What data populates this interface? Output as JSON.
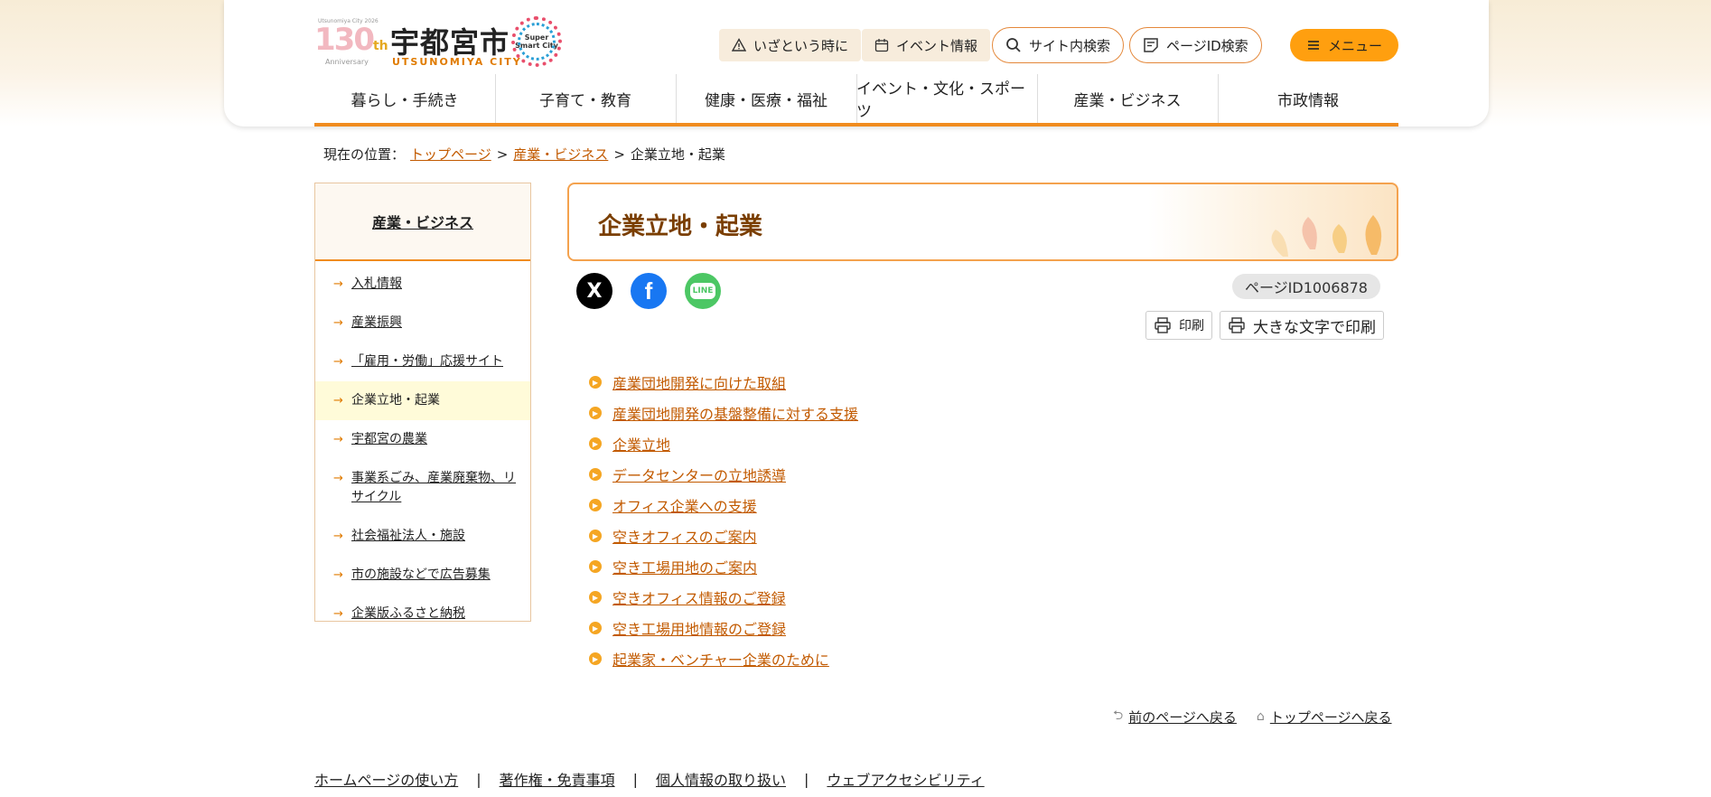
{
  "logo": {
    "anniv_number": "130",
    "anniv_suffix": "th",
    "anniv_top": "Utsunomiya City 2026",
    "anniv_bottom": "Anniversary",
    "city_jp": "宇都宮市",
    "city_en": "UTSUNOMIYA CITY",
    "ssc_text": "Super Smart City"
  },
  "header": {
    "emergency": "いざという時に",
    "events": "イベント情報",
    "site_search": "サイト内検索",
    "pageid_search": "ページID検索",
    "menu": "メニュー"
  },
  "gnav": [
    "暮らし・手続き",
    "子育て・教育",
    "健康・医療・福祉",
    "イベント・文化・スポーツ",
    "産業・ビジネス",
    "市政情報"
  ],
  "breadcrumb": {
    "label": "現在の位置：",
    "items": [
      "トップページ",
      "産業・ビジネス"
    ],
    "current": "企業立地・起業",
    "sep": ">"
  },
  "sidebar": {
    "heading": "産業・ビジネス",
    "items": [
      "入札情報",
      "産業振興",
      "「雇用・労働」応援サイト",
      "企業立地・起業",
      "宇都宮の農業",
      "事業系ごみ、産業廃棄物、リサイクル",
      "社会福祉法人・施設",
      "市の施設などで広告募集",
      "企業版ふるさと納税"
    ],
    "current_index": 3
  },
  "main": {
    "title": "企業立地・起業",
    "page_id": "ページID1006878",
    "print": "印刷",
    "print_large": "大きな文字で印刷",
    "social": {
      "x": "X",
      "facebook": "f",
      "line": "LINE"
    },
    "links": [
      "産業団地開発に向けた取組",
      "産業団地開発の基盤整備に対する支援",
      "企業立地",
      "データセンターの立地誘導",
      "オフィス企業への支援",
      "空きオフィスのご案内",
      "空き工場用地のご案内",
      "空きオフィス情報のご登録",
      "空き工場用地情報のご登録",
      "起業家・ベンチャー企業のために"
    ],
    "back": "前のページへ戻る",
    "top": "トップページへ戻る"
  },
  "footer": {
    "links": [
      "ホームページの使い方",
      "著作権・免責事項",
      "個人情報の取り扱い",
      "ウェブアクセシビリティ"
    ]
  },
  "colors": {
    "accent": "#f08c1f",
    "link": "#c25a00",
    "menu_bg": "#ff9f0f"
  }
}
